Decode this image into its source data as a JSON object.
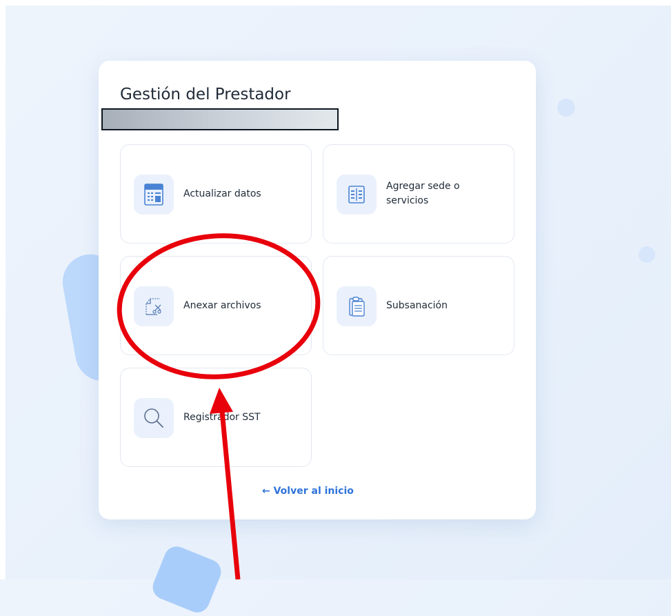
{
  "page": {
    "title": "Gestión del Prestador"
  },
  "tiles": [
    {
      "label": "Actualizar datos",
      "icon": "calculator-icon"
    },
    {
      "label": "Agregar sede o servicios",
      "icon": "list-columns-icon"
    },
    {
      "label": "Anexar archivos",
      "icon": "document-scissors-icon"
    },
    {
      "label": "Subsanación",
      "icon": "clipboard-icon"
    },
    {
      "label": "Registrador SST",
      "icon": "magnifier-icon"
    }
  ],
  "back_link": {
    "label": "← Volver al inicio"
  },
  "colors": {
    "accent": "#2f73d9",
    "icon": "#4a82d4",
    "icon_bg": "#eaf1fc",
    "annotation": "#e8000b"
  }
}
